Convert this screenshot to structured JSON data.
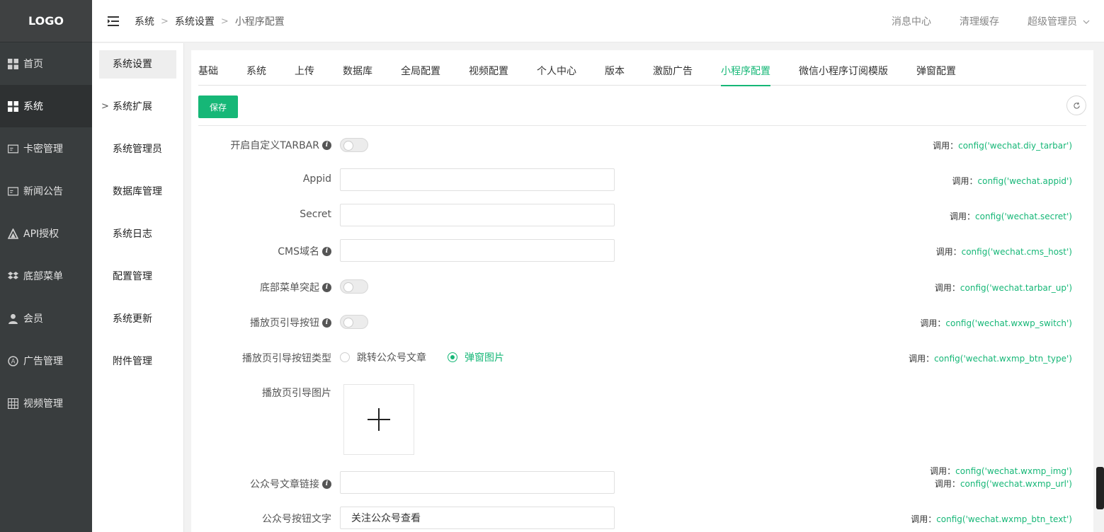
{
  "logo": "LOGO",
  "sidebar": {
    "items": [
      {
        "label": "首页",
        "icon": "grid-icon"
      },
      {
        "label": "系统",
        "icon": "grid-icon",
        "active": true
      },
      {
        "label": "卡密管理",
        "icon": "card-icon"
      },
      {
        "label": "新闻公告",
        "icon": "card-icon"
      },
      {
        "label": "API授权",
        "icon": "triangle-icon"
      },
      {
        "label": "底部菜单",
        "icon": "dropbox-icon"
      },
      {
        "label": "会员",
        "icon": "user-icon"
      },
      {
        "label": "广告管理",
        "icon": "ad-icon"
      },
      {
        "label": "视频管理",
        "icon": "table-icon"
      }
    ]
  },
  "breadcrumb": {
    "a": "系统",
    "b": "系统设置",
    "c": "小程序配置"
  },
  "header_right": {
    "messages": "消息中心",
    "cache": "清理缓存",
    "user": "超级管理员"
  },
  "subnav": {
    "items": [
      "系统设置",
      "系统扩展",
      "系统管理员",
      "数据库管理",
      "系统日志",
      "配置管理",
      "系统更新",
      "附件管理"
    ]
  },
  "tabs": [
    "基础",
    "系统",
    "上传",
    "数据库",
    "全局配置",
    "视频配置",
    "个人中心",
    "版本",
    "激励广告",
    "小程序配置",
    "微信小程序订阅模版",
    "弹窗配置"
  ],
  "active_tab": "小程序配置",
  "save_label": "保存",
  "hint_prefix": "调用：",
  "form": {
    "tarbar": {
      "label": "开启自定义TARBAR",
      "hint": "config('wechat.diy_tarbar')"
    },
    "appid": {
      "label": "Appid",
      "value": "",
      "hint": "config('wechat.appid')"
    },
    "secret": {
      "label": "Secret",
      "value": "",
      "hint": "config('wechat.secret')"
    },
    "cms": {
      "label": "CMS域名",
      "value": "",
      "hint": "config('wechat.cms_host')"
    },
    "tarbar_up": {
      "label": "底部菜单突起",
      "hint": "config('wechat.tarbar_up')"
    },
    "wxwp_switch": {
      "label": "播放页引导按钮",
      "hint": "config('wechat.wxwp_switch')"
    },
    "btn_type": {
      "label": "播放页引导按钮类型",
      "opt1": "跳转公众号文章",
      "opt2": "弹窗图片",
      "hint": "config('wechat.wxmp_btn_type')"
    },
    "img": {
      "label": "播放页引导图片",
      "hint": "config('wechat.wxmp_img')"
    },
    "url": {
      "label": "公众号文章链接",
      "value": "",
      "hint": "config('wechat.wxmp_url')"
    },
    "btn_text": {
      "label": "公众号按钮文字",
      "value": "关注公众号查看",
      "hint": "config('wechat.wxmp_btn_text')"
    }
  },
  "colors": {
    "accent": "#16b777",
    "sidebar_bg": "#393d3e",
    "sidebar_active": "#2e3132"
  }
}
